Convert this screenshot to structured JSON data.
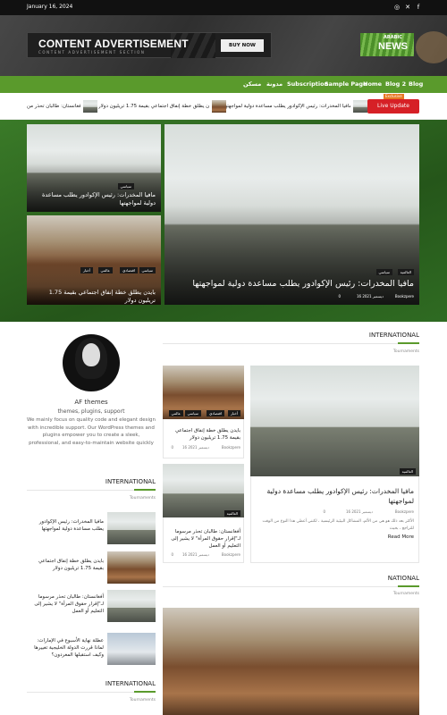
{
  "topbar": {
    "date": "January 16, 2024",
    "social": [
      "instagram-icon",
      "twitter-icon",
      "facebook-icon"
    ]
  },
  "ad": {
    "title": "CONTENT ADVERTISEMENT",
    "subtitle": "CONTENT ADVERTISEMENT SECTION",
    "button": "BUY NOW"
  },
  "logo": {
    "arabic": "ARABIC",
    "news": "NEWS"
  },
  "nav": {
    "items": [
      "Blog",
      "Blog 2",
      "Home",
      "Sample Page",
      "Subscription",
      "مدونة",
      "مسكن"
    ]
  },
  "ticker": {
    "live": "Live Update",
    "exclusive": "Exclusive",
    "items": [
      "مافيا المخدرات: رئيس الإكوادور يطلب مساعدة دولية لمواجهتها",
      "بايدن يطلق خطة إنفاق اجتماعي بقيمة 1.75 تريليون دولار",
      "أفغانستان: طالبان تحذر من"
    ]
  },
  "featured": {
    "small1": {
      "tag": "سياسي",
      "title": "مافيا المخدرات: رئيس الإكوادور يطلب مساعدة دولية لمواجهتها"
    },
    "small2": {
      "tags": [
        "سياسي",
        "اقتصادي",
        "عالمي",
        "أخبار"
      ],
      "title": "بايدن يطلق خطة إنفاق اجتماعي بقيمة 1.75 تريليون دولار"
    },
    "main": {
      "tags": [
        "العالمية",
        "سياسي"
      ],
      "title": "مافيا المخدرات: رئيس الإكوادور يطلب مساعدة دولية لمواجهتها",
      "author": "Bookzpere",
      "date": "16 ديسمبر 2021",
      "comments": "0"
    }
  },
  "about": {
    "name": "AF themes",
    "subtitle": "themes, plugins, support",
    "text": "We mainly focus on quality code and elegant design with incredible support. Our WordPress themes and plugins empower you to create a sleek, professional, and easy-to-maintain website quickly"
  },
  "sidebar": {
    "title": "INTERNATIONAL",
    "sub": "Tournaments",
    "items": [
      "مافيا المخدرات: رئيس الإكوادور يطلب مساعدة دولية لمواجهتها",
      "بايدن يطلق خطة إنفاق اجتماعي بقيمة 1.75 تريليون دولار",
      "أفغانستان: طالبان تحذر مرسوما لـ\"إقرار حقوق المرأة\" لا يشير إلى التعليم أو العمل",
      "عطلة نهاية الأسبوع في الإمارات: لماذا قررت الدولة الخليجية تغييرها وكيف استقبلها المغردون؟"
    ],
    "title2": "INTERNATIONAL",
    "sub2": "Tournaments"
  },
  "intl": {
    "title": "INTERNATIONAL",
    "sub": "Tournaments",
    "big": {
      "tag": "العالمية",
      "title": "مافيا المخدرات: رئيس الإكوادور يطلب مساعدة دولية لمواجهتها",
      "author": "Bookzpere",
      "date": "16 ديسمبر 2021",
      "comments": "0",
      "excerpt": "الأكثر بعد ذلك هو هي من الألم، المشاكل البيئية الرئيسية ، لكنني أعطي هذا النوع من الوقت للتراجع ، بحيث",
      "read_more": "Read More"
    },
    "card1": {
      "tags": [
        "أخبار",
        "اقتصادي",
        "سياسي",
        "عالمي"
      ],
      "title": "بايدن يطلق خطة إنفاق اجتماعي بقيمة 1.75 تريليون دولار",
      "author": "Bookzpere",
      "date": "16 ديسمبر 2021",
      "comments": "0"
    },
    "card2": {
      "tag": "العالمية",
      "title": "أفغانستان: طالبان تحذر مرسوما لـ\"إقرار حقوق المرأة\" لا يشير إلى التعليم أو العمل",
      "author": "Bookzpere",
      "date": "16 ديسمبر 2021",
      "comments": "0"
    }
  },
  "national": {
    "title": "NATIONAL",
    "sub": "Tournaments"
  }
}
